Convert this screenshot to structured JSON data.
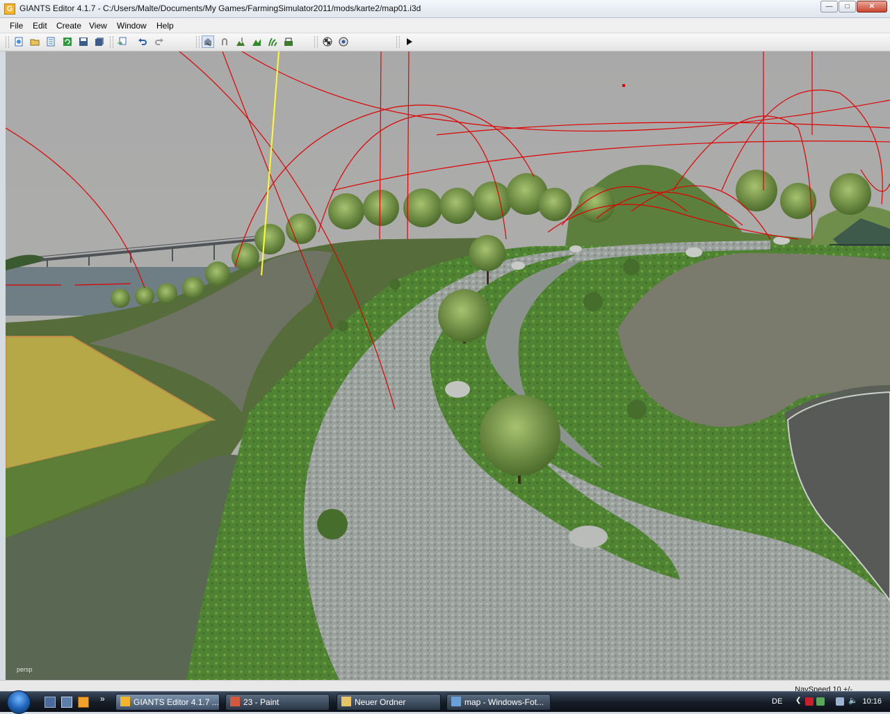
{
  "window": {
    "title": "GIANTS Editor 4.1.7 - C:/Users/Malte/Documents/My Games/FarmingSimulator2011/mods/karte2/map01.i3d",
    "icon_letter": "G"
  },
  "menu": [
    "File",
    "Edit",
    "Create",
    "View",
    "Window",
    "Help"
  ],
  "toolbar": {
    "icons": [
      "new-icon",
      "open-icon",
      "list-icon",
      "refresh-icon",
      "save-icon",
      "save-all-icon",
      "import-icon",
      "undo-icon",
      "redo-icon",
      "select-icon",
      "magnet-icon",
      "terrain-sculpt-icon",
      "terrain-paint-icon",
      "foliage-paint-icon",
      "terrain-smooth-icon",
      "render-icon",
      "render-settings-icon",
      "play-icon"
    ]
  },
  "viewport": {
    "camera_label": "persp"
  },
  "status": {
    "navspeed": "NavSpeed 10 +/-"
  },
  "taskbar": {
    "buttons": [
      {
        "label": "GIANTS Editor 4.1.7 ...",
        "active": true
      },
      {
        "label": "23 - Paint",
        "active": false
      },
      {
        "label": "Neuer Ordner",
        "active": false
      },
      {
        "label": "map - Windows-Fot...",
        "active": false
      }
    ],
    "more": "»",
    "language": "DE",
    "clock": "10:16"
  },
  "colors": {
    "sky": "#a8a8a8",
    "grass": "#5f8a3a",
    "road": "#9aa39d",
    "field": "#b9ab4a",
    "gizmo": "#e00000",
    "gizmo_highlight": "#ffff30"
  }
}
